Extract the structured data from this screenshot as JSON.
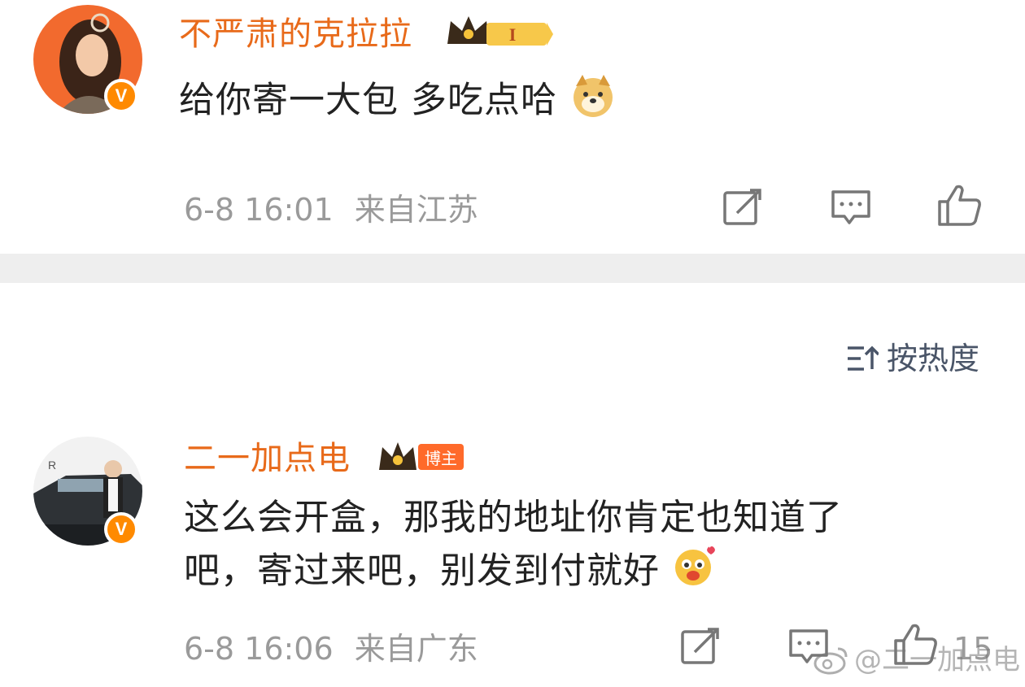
{
  "comment1": {
    "username": "不严肃的克拉拉",
    "level_badge": "I",
    "text": "给你寄一大包 多吃点哈",
    "emoji": "doge-emoji",
    "time": "6-8 16:01",
    "location": "来自江苏"
  },
  "sort": {
    "label": "按热度",
    "icon": "sort-icon"
  },
  "comment2": {
    "username": "二一加点电",
    "role_badge": "博主",
    "text_line1": "这么会开盒，那我的地址你肯定也知道了",
    "text_line2": "吧，寄过来吧，别发到付就好",
    "emoji": "heart-eyes-emoji",
    "time": "6-8 16:06",
    "location": "来自广东",
    "likes": "15"
  },
  "watermark": "@二一加点电",
  "colors": {
    "username": "#e86a1a",
    "verified": "#ff8a00",
    "meta": "#9a9a9a",
    "divider": "#eeeeee"
  }
}
